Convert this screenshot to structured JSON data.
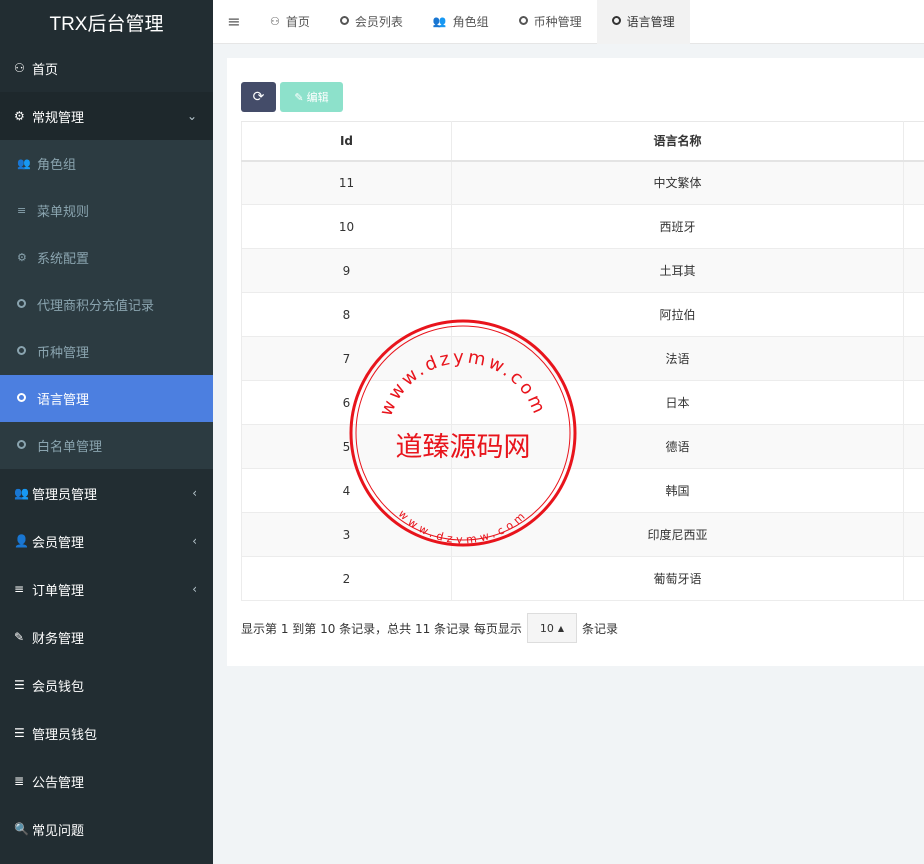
{
  "app": {
    "title": "TRX后台管理"
  },
  "sidebar": {
    "items": [
      {
        "name": "home",
        "icon": "dashboard-icon",
        "glyph": "⚇",
        "label": "首页"
      },
      {
        "name": "general",
        "icon": "cogs-icon",
        "glyph": "⚙",
        "label": "常规管理",
        "arrow": "⌄"
      }
    ],
    "sub": [
      {
        "name": "role-group",
        "glyph": "👥",
        "label": "角色组"
      },
      {
        "name": "menu-rules",
        "glyph": "≡",
        "label": "菜单规则"
      },
      {
        "name": "system-config",
        "glyph": "⚙",
        "label": "系统配置"
      },
      {
        "name": "agent-recharge",
        "glyph": "ring",
        "label": "代理商积分充值记录"
      },
      {
        "name": "currency",
        "glyph": "ring",
        "label": "币种管理"
      },
      {
        "name": "language",
        "glyph": "ring",
        "label": "语言管理",
        "active": true
      },
      {
        "name": "whitelist",
        "glyph": "ring",
        "label": "白名单管理"
      }
    ],
    "bottom": [
      {
        "name": "admin-manage",
        "icon": "users-icon",
        "glyph": "👥",
        "label": "管理员管理",
        "arrow": "‹"
      },
      {
        "name": "member-manage",
        "icon": "user-icon",
        "glyph": "👤",
        "label": "会员管理",
        "arrow": "‹"
      },
      {
        "name": "order-manage",
        "icon": "list-icon",
        "glyph": "≡",
        "label": "订单管理",
        "arrow": "‹"
      },
      {
        "name": "finance-manage",
        "icon": "edit-icon",
        "glyph": "✎",
        "label": "财务管理"
      },
      {
        "name": "member-wallet",
        "icon": "list-alt-icon",
        "glyph": "☰",
        "label": "会员钱包"
      },
      {
        "name": "admin-wallet",
        "icon": "list-ul-icon",
        "glyph": "☰",
        "label": "管理员钱包"
      },
      {
        "name": "notice-manage",
        "icon": "bars-icon",
        "glyph": "≣",
        "label": "公告管理"
      },
      {
        "name": "faq",
        "icon": "search-icon",
        "glyph": "🔍",
        "label": "常见问题"
      }
    ]
  },
  "tabs": [
    {
      "name": "home",
      "icon": "dashboard-icon",
      "glyph": "⚇",
      "label": "首页"
    },
    {
      "name": "member-list",
      "icon": "circle-icon",
      "glyph": "ring",
      "label": "会员列表"
    },
    {
      "name": "role-group",
      "icon": "users-icon",
      "glyph": "👥",
      "label": "角色组"
    },
    {
      "name": "currency",
      "icon": "circle-icon",
      "glyph": "ring",
      "label": "币种管理"
    },
    {
      "name": "language",
      "icon": "circle-icon",
      "glyph": "ring",
      "label": "语言管理",
      "active": true
    }
  ],
  "toolbar": {
    "refresh_icon": "refresh-icon",
    "edit_label": "编辑",
    "edit_icon": "pencil-icon"
  },
  "table": {
    "headers": [
      "Id",
      "语言名称",
      ""
    ],
    "rows": [
      [
        "11",
        "中文繁体"
      ],
      [
        "10",
        "西班牙"
      ],
      [
        "9",
        "土耳其"
      ],
      [
        "8",
        "阿拉伯"
      ],
      [
        "7",
        "法语"
      ],
      [
        "6",
        "日本"
      ],
      [
        "5",
        "德语"
      ],
      [
        "4",
        "韩国"
      ],
      [
        "3",
        "印度尼西亚"
      ],
      [
        "2",
        "葡萄牙语"
      ]
    ]
  },
  "pager": {
    "summary": "显示第 1 到第 10 条记录，总共 11 条记录 每页显示",
    "page_size": "10",
    "suffix": "条记录"
  },
  "watermark": {
    "center": "道臻源码网",
    "top_ring": "www.dzymw.com",
    "bottom_ring": "www.dzymw.com",
    "color": "#e8141c"
  }
}
